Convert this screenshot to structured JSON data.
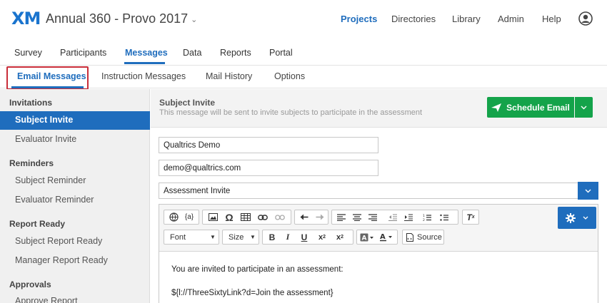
{
  "brand": {
    "logo": "XM",
    "project_title": "Annual 360 - Provo 2017"
  },
  "topnav": [
    {
      "label": "Projects",
      "active": true
    },
    {
      "label": "Directories",
      "active": false
    },
    {
      "label": "Library",
      "active": false
    },
    {
      "label": "Admin",
      "active": false
    },
    {
      "label": "Help",
      "active": false
    }
  ],
  "main_tabs": [
    {
      "label": "Survey"
    },
    {
      "label": "Participants"
    },
    {
      "label": "Messages"
    },
    {
      "label": "Data"
    },
    {
      "label": "Reports"
    },
    {
      "label": "Portal"
    }
  ],
  "main_tab_active": "Messages",
  "sub_tabs": [
    {
      "label": "Email Messages"
    },
    {
      "label": "Instruction Messages"
    },
    {
      "label": "Mail History"
    },
    {
      "label": "Options"
    }
  ],
  "sidebar": {
    "groups": [
      {
        "title": "Invitations",
        "items": [
          "Subject Invite",
          "Evaluator Invite"
        ]
      },
      {
        "title": "Reminders",
        "items": [
          "Subject Reminder",
          "Evaluator Reminder"
        ]
      },
      {
        "title": "Report Ready",
        "items": [
          "Subject Report Ready",
          "Manager Report Ready"
        ]
      },
      {
        "title": "Approvals",
        "items": [
          "Approve Report"
        ]
      }
    ],
    "active_item": "Subject Invite"
  },
  "message": {
    "title": "Subject Invite",
    "description": "This message will be sent to invite subjects to participate in the assessment",
    "schedule_label": "Schedule Email"
  },
  "form": {
    "from_name": "Qualtrics Demo",
    "from_email": "demo@qualtrics.com",
    "subject": "Assessment Invite"
  },
  "toolbar": {
    "font_label": "Font",
    "size_label": "Size",
    "bold": "B",
    "italic": "I",
    "underline": "U",
    "source_label": "Source",
    "piped_text": "{a}"
  },
  "editor": {
    "line1": "You are invited to participate in an assessment:",
    "line2": "${l://ThreeSixtyLink?d=Join the assessment}"
  },
  "colors": {
    "accent": "#1f6dbd",
    "success": "#14a34a",
    "highlight_box": "#c92d39"
  }
}
